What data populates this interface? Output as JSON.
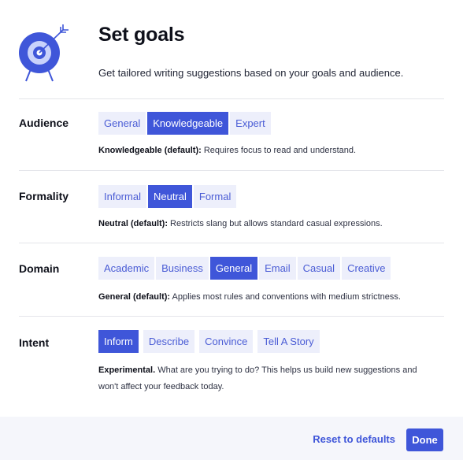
{
  "header": {
    "title": "Set goals",
    "subtitle": "Get tailored writing suggestions based on your goals and audience.",
    "icon": "target-arrow-icon"
  },
  "colors": {
    "accent": "#3f56d9",
    "option_bg": "#edeffb",
    "footer_bg": "#f5f6fb"
  },
  "audience": {
    "label": "Audience",
    "options": [
      "General",
      "Knowledgeable",
      "Expert"
    ],
    "selected": "Knowledgeable",
    "desc_strong": "Knowledgeable (default):",
    "desc_text": " Requires focus to read and understand."
  },
  "formality": {
    "label": "Formality",
    "options": [
      "Informal",
      "Neutral",
      "Formal"
    ],
    "selected": "Neutral",
    "desc_strong": "Neutral (default):",
    "desc_text": " Restricts slang but allows standard casual expressions."
  },
  "domain": {
    "label": "Domain",
    "options": [
      "Academic",
      "Business",
      "General",
      "Email",
      "Casual",
      "Creative"
    ],
    "selected": "General",
    "desc_strong": "General (default):",
    "desc_text": " Applies most rules and conventions with medium strictness."
  },
  "intent": {
    "label": "Intent",
    "options": [
      "Inform",
      "Describe",
      "Convince",
      "Tell A Story"
    ],
    "selected": "Inform",
    "desc_strong": "Experimental.",
    "desc_text": " What are you trying to do? This helps us build new suggestions and won't affect your feedback today."
  },
  "footer": {
    "reset_label": "Reset to defaults",
    "done_label": "Done"
  }
}
